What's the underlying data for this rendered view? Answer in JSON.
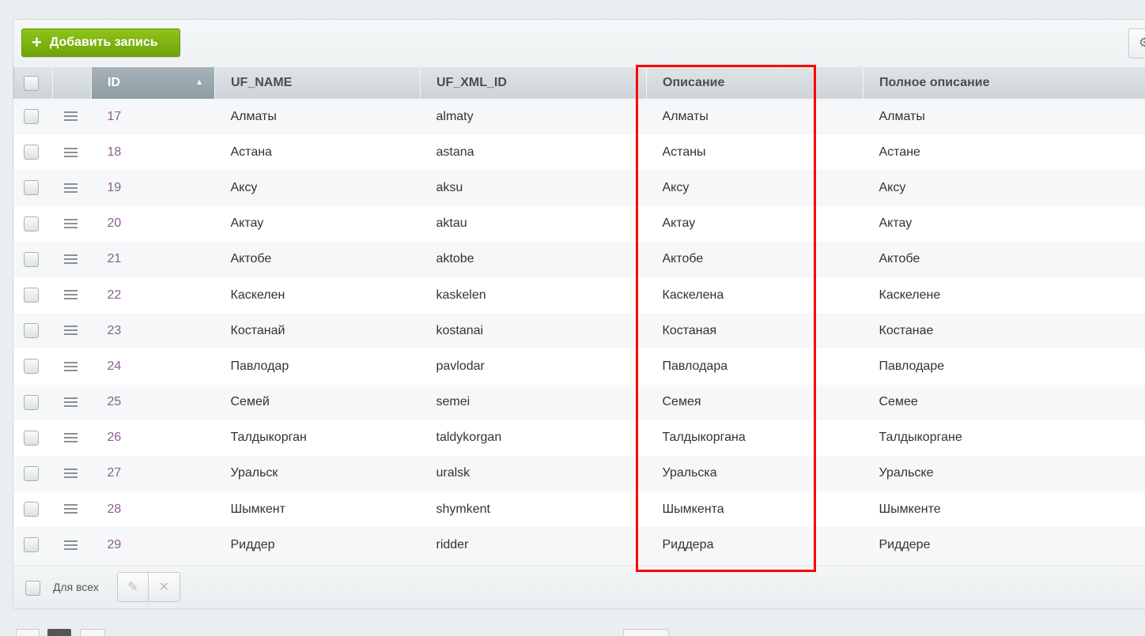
{
  "toolbar": {
    "add_label": "Добавить запись",
    "add_icon": "plus-icon",
    "settings_icon": "gear-icon"
  },
  "columns": [
    "ID",
    "UF_NAME",
    "UF_XML_ID",
    "Описание",
    "Полное описание"
  ],
  "sorted_column": "ID",
  "rows": [
    {
      "id": "17",
      "name": "Алматы",
      "xml": "almaty",
      "desc": "Алматы",
      "full": "Алматы"
    },
    {
      "id": "18",
      "name": "Астана",
      "xml": "astana",
      "desc": "Астаны",
      "full": "Астане"
    },
    {
      "id": "19",
      "name": "Аксу",
      "xml": "aksu",
      "desc": "Аксу",
      "full": "Аксу"
    },
    {
      "id": "20",
      "name": "Актау",
      "xml": "aktau",
      "desc": "Актау",
      "full": "Актау"
    },
    {
      "id": "21",
      "name": "Актобе",
      "xml": "aktobe",
      "desc": "Актобе",
      "full": "Актобе"
    },
    {
      "id": "22",
      "name": "Каскелен",
      "xml": "kaskelen",
      "desc": "Каскелена",
      "full": "Каскелене"
    },
    {
      "id": "23",
      "name": "Костанай",
      "xml": "kostanai",
      "desc": "Костаная",
      "full": "Костанае"
    },
    {
      "id": "24",
      "name": "Павлодар",
      "xml": "pavlodar",
      "desc": "Павлодара",
      "full": "Павлодаре"
    },
    {
      "id": "25",
      "name": "Семей",
      "xml": "semei",
      "desc": "Семея",
      "full": "Семее"
    },
    {
      "id": "26",
      "name": "Талдыкорган",
      "xml": "taldykorgan",
      "desc": "Талдыкоргана",
      "full": "Талдыкоргане"
    },
    {
      "id": "27",
      "name": "Уральск",
      "xml": "uralsk",
      "desc": "Уральска",
      "full": "Уральске"
    },
    {
      "id": "28",
      "name": "Шымкент",
      "xml": "shymkent",
      "desc": "Шымкента",
      "full": "Шымкенте"
    },
    {
      "id": "29",
      "name": "Риддер",
      "xml": "ridder",
      "desc": "Риддера",
      "full": "Риддере"
    }
  ],
  "footer": {
    "for_all_label": "Для всех",
    "edit_icon": "pencil-icon",
    "delete_icon": "close-icon"
  },
  "colors": {
    "accent_green": "#7db414",
    "highlight_red": "#ff0000",
    "id_link": "#8a5f8f"
  }
}
